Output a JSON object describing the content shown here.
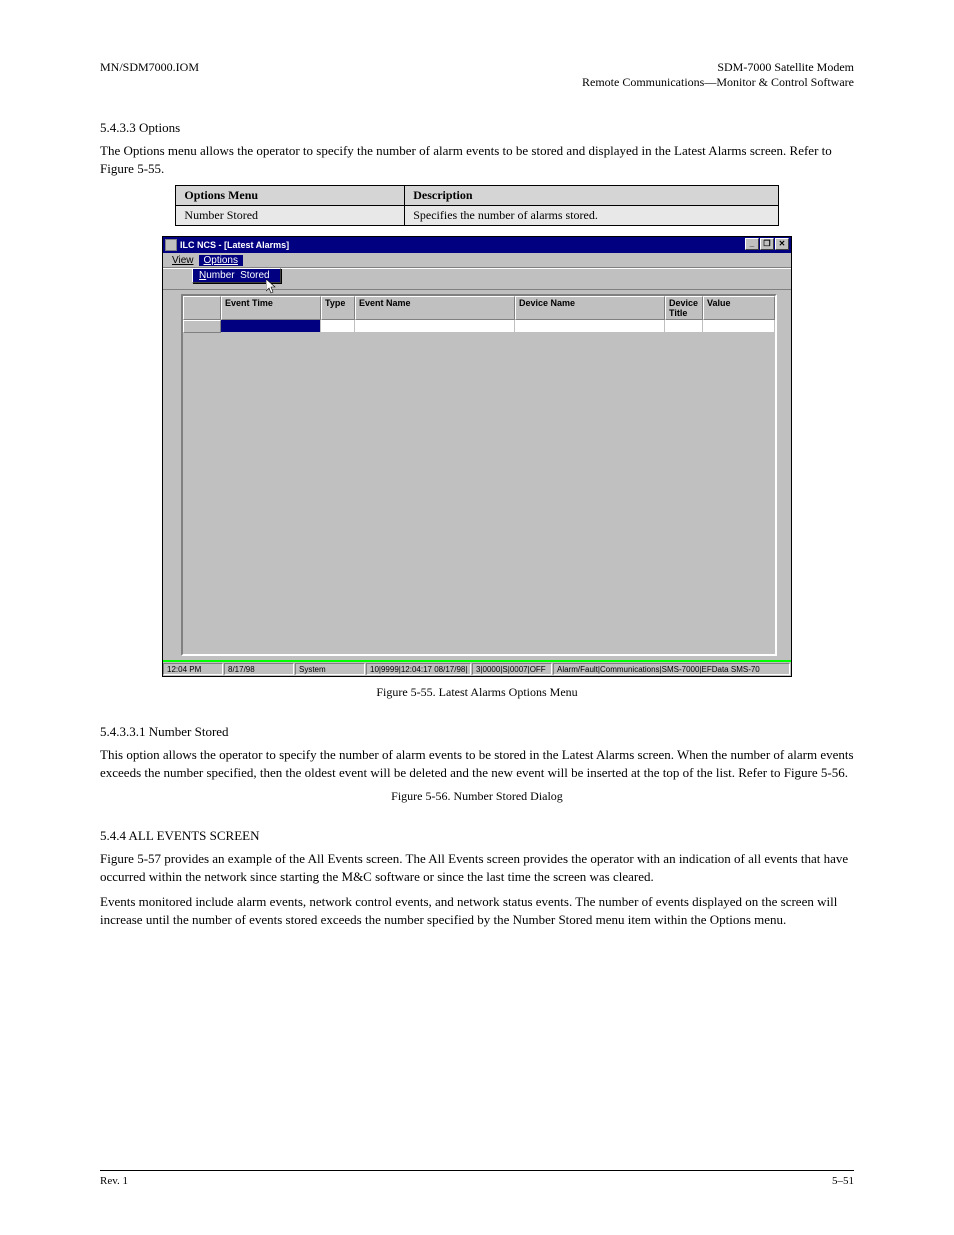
{
  "header": {
    "left": "MN/SDM7000.IOM",
    "right_line1": "SDM-7000 Satellite Modem",
    "right_line2": "Remote Communications—Monitor & Control Software"
  },
  "sections": {
    "options_title": "5.4.3.3  Options",
    "options_intro": "The Options menu allows the operator to specify the number of alarm events to be stored and displayed in the Latest Alarms screen. Refer to Figure 5-55.",
    "table_header_menu": "Options Menu",
    "table_header_desc": "Description",
    "table_row_menu": "Number Stored",
    "table_row_desc": "Specifies the number of alarms stored.",
    "caption_55": "Figure 5-55. Latest Alarms Options Menu",
    "num_stored_title": "5.4.3.3.1  Number Stored",
    "num_stored_body": "This option allows the operator to specify the number of alarm events to be stored in the Latest Alarms screen. When the number of alarm events exceeds the number specified, then the oldest event will be deleted and the new event will be inserted at the top of the list. Refer to Figure 5-56.",
    "caption_56": "Figure 5-56. Number Stored Dialog",
    "all_events_title": "5.4.4  ALL EVENTS SCREEN",
    "all_events_p1": "Figure 5-57 provides an example of the All Events screen. The All Events screen provides the operator with an indication of all events that have occurred within the network since starting the M&C software or since the last time the screen was cleared.",
    "all_events_p2": "Events monitored include alarm events, network control events, and network status events. The number of events displayed on the screen will increase until the number of events stored exceeds the number specified by the Number Stored menu item within the Options menu."
  },
  "screenshot": {
    "title": "ILC NCS - [Latest Alarms]",
    "menus": {
      "view": "View",
      "options": "Options"
    },
    "dropdown": {
      "item1": "Number  Stored"
    },
    "columns": {
      "rowhdr": "",
      "event_time": "Event Time",
      "type": "Type",
      "event_name": "Event Name",
      "device_name": "Device Name",
      "device_title": "Device Title",
      "value": "Value"
    },
    "winbtns": {
      "min": "_",
      "max": "❐",
      "close": "✕"
    },
    "status": {
      "time": "12:04 PM",
      "date": "8/17/98",
      "owner": "System",
      "msg1": "10|9999|12:04:17 08/17/98|",
      "msg2": "3|0000|S|0007|OFF",
      "msg3": "Alarm/Fault|Communications|SMS-7000|EFData SMS-70"
    }
  },
  "footer": {
    "left": "Rev. 1",
    "right": "5–51"
  }
}
